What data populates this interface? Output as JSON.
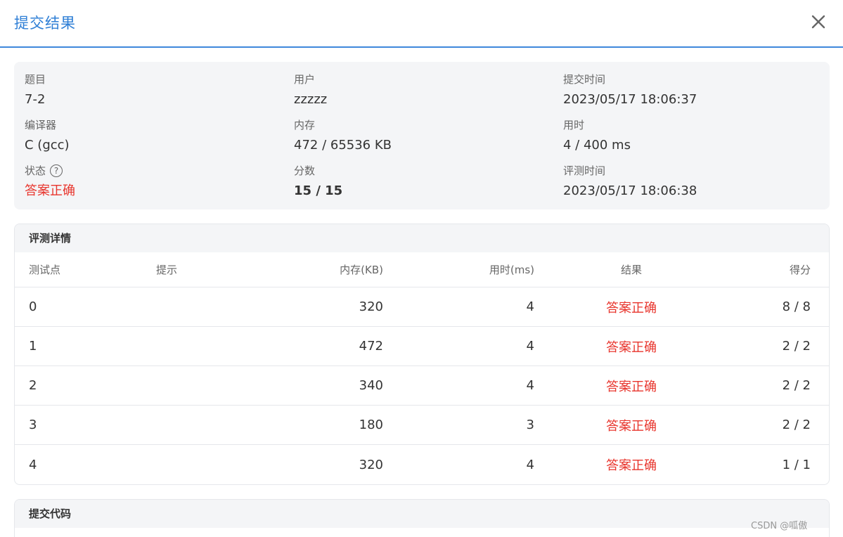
{
  "dialog": {
    "title": "提交结果",
    "close_icon": "close-icon"
  },
  "summary": {
    "problem": {
      "label": "题目",
      "value": "7-2"
    },
    "user": {
      "label": "用户",
      "value": "zzzzz"
    },
    "submit_time": {
      "label": "提交时间",
      "value": "2023/05/17 18:06:37"
    },
    "compiler": {
      "label": "编译器",
      "value": "C (gcc)"
    },
    "memory": {
      "label": "内存",
      "value": "472 / 65536 KB"
    },
    "time_used": {
      "label": "用时",
      "value": "4 / 400 ms"
    },
    "status": {
      "label": "状态",
      "help_icon": "?",
      "value": "答案正确",
      "color": "#e8352d"
    },
    "score": {
      "label": "分数",
      "value": "15 / 15"
    },
    "judge_time": {
      "label": "评测时间",
      "value": "2023/05/17 18:06:38"
    }
  },
  "detail": {
    "title": "评测详情",
    "columns": [
      "测试点",
      "提示",
      "内存(KB)",
      "用时(ms)",
      "结果",
      "得分"
    ],
    "rows": [
      {
        "id": "0",
        "hint": "",
        "memory": "320",
        "time": "4",
        "result": "答案正确",
        "score": "8 / 8"
      },
      {
        "id": "1",
        "hint": "",
        "memory": "472",
        "time": "4",
        "result": "答案正确",
        "score": "2 / 2"
      },
      {
        "id": "2",
        "hint": "",
        "memory": "340",
        "time": "4",
        "result": "答案正确",
        "score": "2 / 2"
      },
      {
        "id": "3",
        "hint": "",
        "memory": "180",
        "time": "3",
        "result": "答案正确",
        "score": "2 / 2"
      },
      {
        "id": "4",
        "hint": "",
        "memory": "320",
        "time": "4",
        "result": "答案正确",
        "score": "1 / 1"
      }
    ]
  },
  "code_section": {
    "title": "提交代码"
  },
  "watermark": "CSDN @呱傲"
}
